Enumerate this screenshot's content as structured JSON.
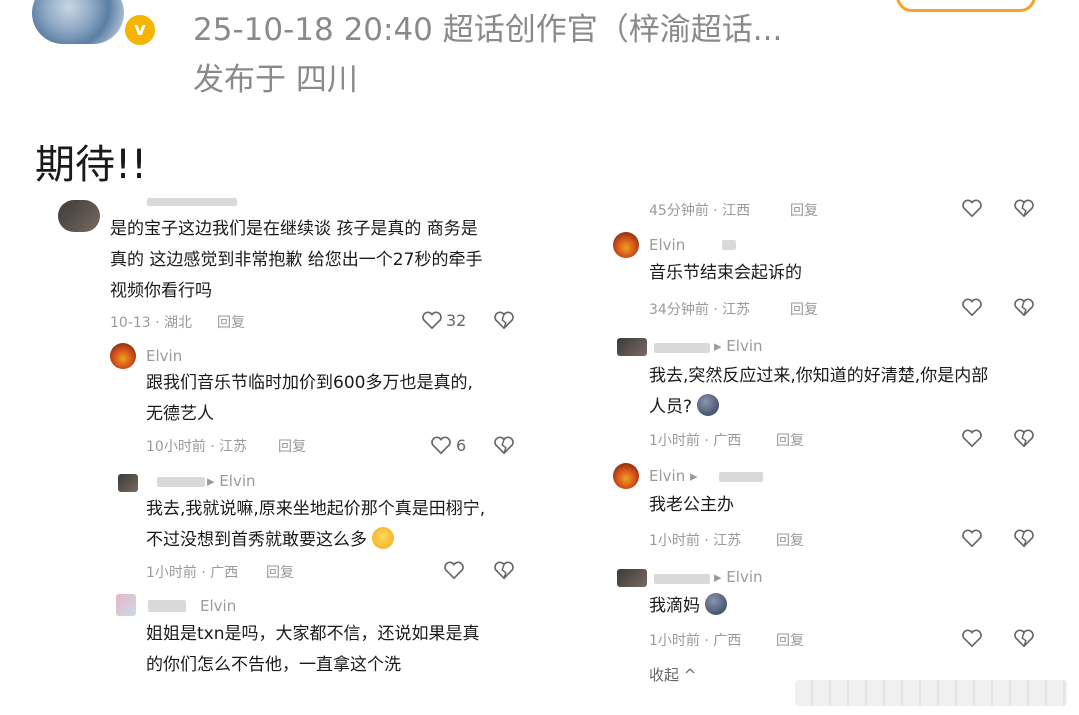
{
  "header": {
    "timestamp_source": "25-10-18 20:40  超话创作官（梓渝超话...",
    "location": "发布于 四川",
    "verified_mark": "v"
  },
  "post": {
    "text": "期待!!"
  },
  "left_shot": {
    "top_comment": {
      "text_line1": "是的宝子这边我们是在继续谈  孩子是真的  商务是",
      "text_line2": "真的 这边感觉到非常抱歉 给您出一个27秒的牵手",
      "text_line3": "视频你看行吗",
      "time": "10-13 · 湖北",
      "reply": "回复",
      "likes": "32"
    },
    "reply1": {
      "name": "Elvin",
      "text_line1": "跟我们音乐节临时加价到600多万也是真的,",
      "text_line2": "无德艺人",
      "time": "10小时前 · 江苏",
      "reply": "回复",
      "likes": "6"
    },
    "reply2": {
      "name": "▸ Elvin",
      "text_line1": "我去,我就说嘛,原来坐地起价那个真是田栩宁,",
      "text_line2": "不过没想到首秀就敢要这么多",
      "time": "1小时前 · 广西",
      "reply": "回复"
    },
    "reply3": {
      "name": "Elvin",
      "text_line1": "姐姐是txn是吗，大家都不信，还说如果是真",
      "text_line2": "的你们怎么不告他，一直拿这个洗"
    }
  },
  "right_shot": {
    "top_meta": {
      "time": "45分钟前 · 江西",
      "reply": "回复"
    },
    "c1": {
      "name": "Elvin",
      "text": "音乐节结束会起诉的",
      "time": "34分钟前 · 江苏",
      "reply": "回复"
    },
    "c2": {
      "name": "▸ Elvin",
      "text_line1": "我去,突然反应过来,你知道的好清楚,你是内部",
      "text_line2": "人员?",
      "time": "1小时前 · 广西",
      "reply": "回复"
    },
    "c3": {
      "name": "Elvin ▸",
      "text": "我老公主办",
      "time": "1小时前 · 江苏",
      "reply": "回复"
    },
    "c4": {
      "name": "▸ Elvin",
      "text": "我滴妈",
      "time": "1小时前 · 广西",
      "reply": "回复"
    },
    "collapse": "收起 ^"
  },
  "colors": {
    "accent_orange": "#f7a32b",
    "verified_yellow": "#f5b400",
    "meta_gray": "#8a8a8a"
  }
}
